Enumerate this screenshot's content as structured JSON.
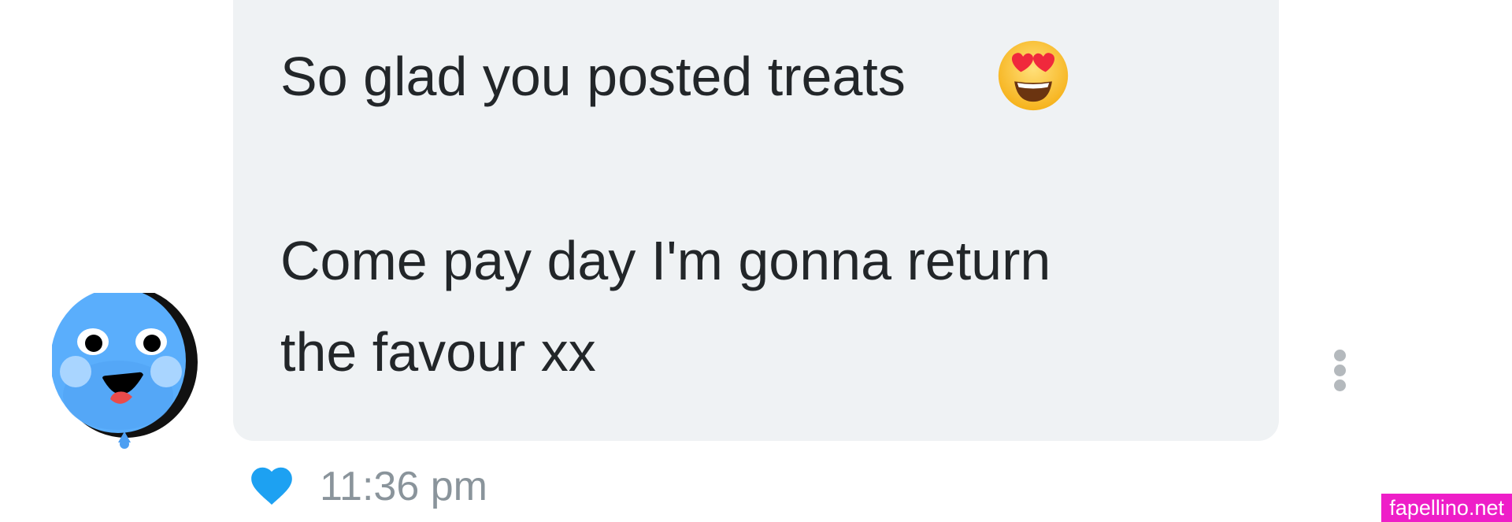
{
  "message": {
    "lines": [
      "So glad you posted treats",
      "Come pay day I'm gonna return",
      "the favour xx"
    ],
    "emoji": "smiling-face-with-heart-eyes",
    "timestamp": "11:36 pm",
    "liked": true
  },
  "avatar": {
    "icon": "smiling-balloon-avatar",
    "color": "#5aaefc"
  },
  "colors": {
    "bubble": "#eff2f4",
    "message_text": "#222629",
    "timestamp": "#8a949b",
    "heart": "#1da1f2",
    "more_dots": "#b4b9bd",
    "watermark_bg": "#ee1ec8"
  },
  "watermark": "fapellino.net"
}
